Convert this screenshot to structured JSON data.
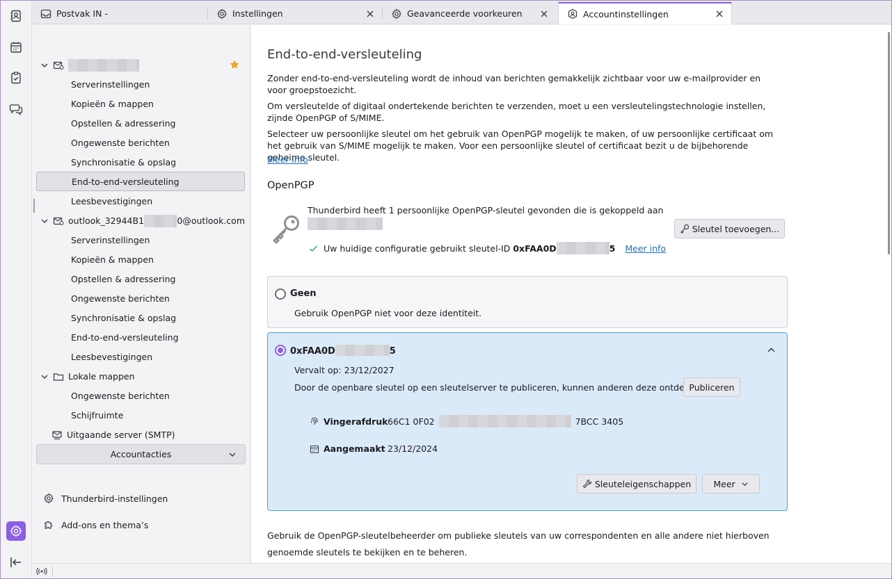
{
  "tabs": [
    {
      "label": "Postvak IN -",
      "icon": "inbox-icon",
      "closable": false
    },
    {
      "label": "Instellingen",
      "icon": "gear-icon",
      "closable": true
    },
    {
      "label": "Geavanceerde voorkeuren",
      "icon": "gear-icon",
      "closable": true
    },
    {
      "label": "Accountinstellingen",
      "icon": "account-settings-icon",
      "closable": true,
      "active": true
    }
  ],
  "sidebar": {
    "account1": {
      "name_hidden": true,
      "items": [
        "Serverinstellingen",
        "Kopieën & mappen",
        "Opstellen & adressering",
        "Ongewenste berichten",
        "Synchronisatie & opslag",
        "End-to-end-versleuteling",
        "Leesbevestigingen"
      ],
      "selected": "End-to-end-versleuteling"
    },
    "account2": {
      "name_prefix": "outlook_32944B1",
      "name_suffix": "0@outlook.com",
      "items": [
        "Serverinstellingen",
        "Kopieën & mappen",
        "Opstellen & adressering",
        "Ongewenste berichten",
        "Synchronisatie & opslag",
        "End-to-end-versleuteling",
        "Leesbevestigingen"
      ]
    },
    "local": {
      "name": "Lokale mappen",
      "items": [
        "Ongewenste berichten",
        "Schijfruimte"
      ]
    },
    "smtp": "Uitgaande server (SMTP)",
    "account_actions": "Accountacties",
    "links": {
      "thunderbird_settings": "Thunderbird-instellingen",
      "addons": "Add-ons en thema’s"
    }
  },
  "main": {
    "title": "End-to-end-versleuteling",
    "para1": "Zonder end-to-end-versleuteling wordt de inhoud van berichten gemakkelijk zichtbaar voor uw e-mailprovider en voor groepstoezicht.",
    "para2": "Om versleutelde of digitaal ondertekende berichten te verzenden, moet u een versleutelingstechnologie instellen, zijnde OpenPGP of S/MIME.",
    "para3": "Selecteer uw persoonlijke sleutel om het gebruik van OpenPGP mogelijk te maken, of uw persoonlijke certificaat om het gebruik van S/MIME mogelijk te maken. Voor een persoonlijke sleutel of certificaat bezit u de bijbehorende geheime sleutel.",
    "more_info": "Meer info",
    "openpgp_heading": "OpenPGP",
    "found_text": "Thunderbird heeft 1 persoonlijke OpenPGP-sleutel gevonden die is gekoppeld aan",
    "config_text": "Uw huidige configuratie gebruikt sleutel-ID",
    "key_id_prefix": "0xFAA0D",
    "key_id_suffix": "5",
    "more_info_2": "Meer info",
    "add_key_button": "Sleutel toevoegen...",
    "none_option": {
      "title": "Geen",
      "desc": "Gebruik OpenPGP niet voor deze identiteit."
    },
    "key_option": {
      "title_prefix": "0xFAA0D",
      "title_suffix": "5",
      "expires": "Vervalt op: 23/12/2027",
      "publish_text": "Door de openbare sleutel op een sleutelserver te publiceren, kunnen anderen deze ontdekken.",
      "publish_button": "Publiceren",
      "fingerprint_label": "Vingerafdruk",
      "fingerprint_prefix": "66C1 0F02",
      "fingerprint_suffix": "7BCC 3405",
      "created_label": "Aangemaakt",
      "created_value": "23/12/2024",
      "key_props_button": "Sleuteleigenschappen",
      "more_button": "Meer"
    },
    "footer": "Gebruik de OpenPGP-sleutelbeheerder om publieke sleutels van uw correspondenten en alle andere niet hierboven genoemde sleutels te bekijken en te beheren."
  },
  "colors": {
    "accent": "#8a5ee6",
    "selected_card": "#dbeaf9",
    "link": "#1f6fb5",
    "check": "#2aa198"
  }
}
